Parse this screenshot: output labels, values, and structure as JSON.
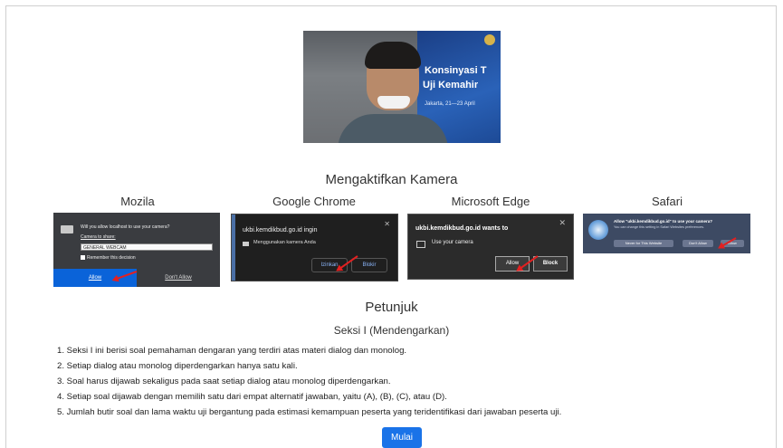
{
  "webcam": {
    "banner_line1": "Konsinyasi T",
    "banner_line2": "Uji Kemahir",
    "banner_line3": "Jakarta, 21—23 April"
  },
  "camera_heading": "Mengaktifkan Kamera",
  "browsers": {
    "mozilla": {
      "name": "Mozila",
      "prompt": "Will you allow localhost to use your camera?",
      "camera_label": "Camera to share:",
      "camera_value": "GENERAL WEBCAM",
      "remember": "Remember this decision",
      "allow": "Allow",
      "deny": "Don't Allow"
    },
    "chrome": {
      "name": "Google Chrome",
      "prompt": "ukbi.kemdikbud.go.id ingin",
      "sub": "Menggunakan kamera Anda",
      "allow": "Izinkan",
      "block": "Blokir"
    },
    "edge": {
      "name": "Microsoft Edge",
      "prompt": "ukbi.kemdikbud.go.id wants to",
      "sub": "Use your camera",
      "allow": "Allow",
      "block": "Block"
    },
    "safari": {
      "name": "Safari",
      "prompt": "Allow \"ukbi.kemdikbud.go.id\" to use your camera?",
      "sub": "You can change this setting in Safari Websites preferences.",
      "never": "Never for This Website",
      "deny": "Don't Allow",
      "allow": "Allow"
    }
  },
  "instructions": {
    "title": "Petunjuk",
    "section": "Seksi I (Mendengarkan)",
    "items": [
      "1. Seksi I ini berisi soal pemahaman dengaran yang terdiri atas materi dialog dan monolog.",
      "2. Setiap dialog atau monolog diperdengarkan hanya satu kali.",
      "3. Soal harus dijawab sekaligus pada saat setiap dialog atau monolog diperdengarkan.",
      "4. Setiap soal dijawab dengan memilih satu dari empat alternatif jawaban, yaitu (A), (B), (C), atau (D).",
      "5. Jumlah butir soal dan lama waktu uji bergantung pada estimasi kemampuan peserta yang teridentifikasi dari jawaban peserta uji."
    ]
  },
  "start_button": "Mulai"
}
